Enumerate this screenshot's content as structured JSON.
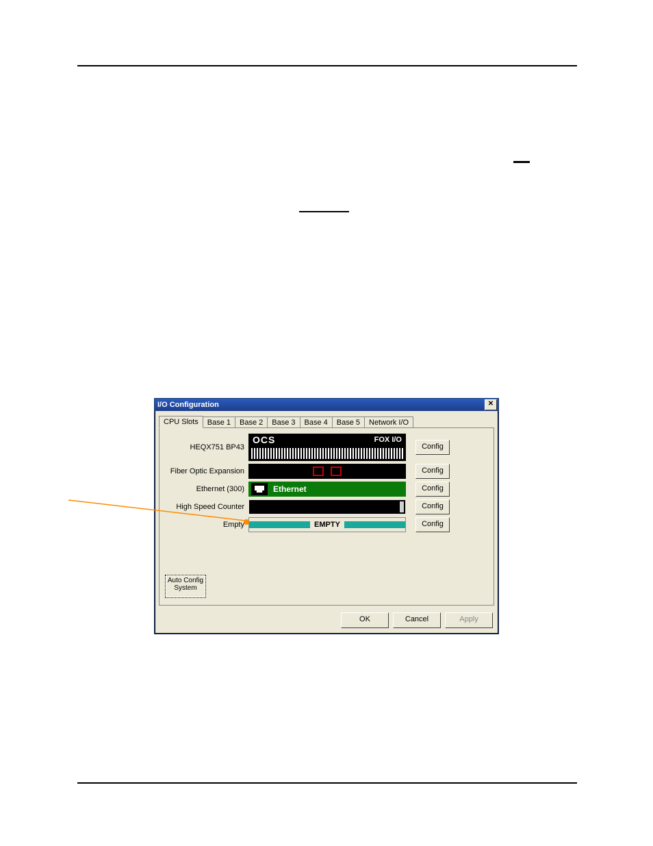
{
  "dialog": {
    "title": "I/O Configuration",
    "close_glyph": "✕",
    "tabs": [
      "CPU Slots",
      "Base 1",
      "Base 2",
      "Base 3",
      "Base 4",
      "Base 5",
      "Network I/O"
    ],
    "rows": [
      {
        "label": "HEQX751 BP43",
        "config": "Config",
        "ocs_text": "OCS",
        "fox_text": "FOX I/O"
      },
      {
        "label": "Fiber Optic Expansion",
        "config": "Config"
      },
      {
        "label": "Ethernet (300)",
        "config": "Config",
        "eth_text": "Ethernet"
      },
      {
        "label": "High Speed Counter",
        "config": "Config"
      },
      {
        "label": "Empty",
        "config": "Config",
        "empty_text": "EMPTY"
      }
    ],
    "auto_config": "Auto Config\nSystem",
    "buttons": {
      "ok": "OK",
      "cancel": "Cancel",
      "apply": "Apply"
    }
  }
}
